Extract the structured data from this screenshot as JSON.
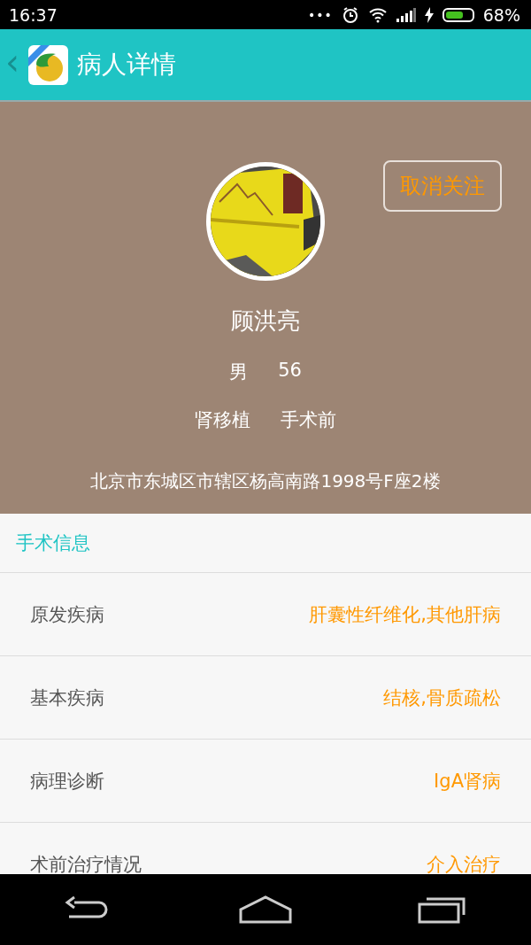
{
  "status_bar": {
    "time": "16:37",
    "dots": "•••",
    "battery_text": "68%"
  },
  "app_bar": {
    "back": "‹",
    "title": "病人详情"
  },
  "profile": {
    "follow_button": "取消关注",
    "name": "顾洪亮",
    "gender": "男",
    "age": "56",
    "category": "肾移植",
    "stage": "手术前",
    "address": "北京市东城区市辖区杨高南路1998号F座2楼"
  },
  "section": {
    "title": "手术信息",
    "rows": [
      {
        "label": "原发疾病",
        "value": "肝囊性纤维化,其他肝病"
      },
      {
        "label": "基本疾病",
        "value": "结核,骨质疏松"
      },
      {
        "label": "病理诊断",
        "value": "IgA肾病"
      },
      {
        "label": "术前治疗情况",
        "value": "介入治疗"
      }
    ]
  }
}
